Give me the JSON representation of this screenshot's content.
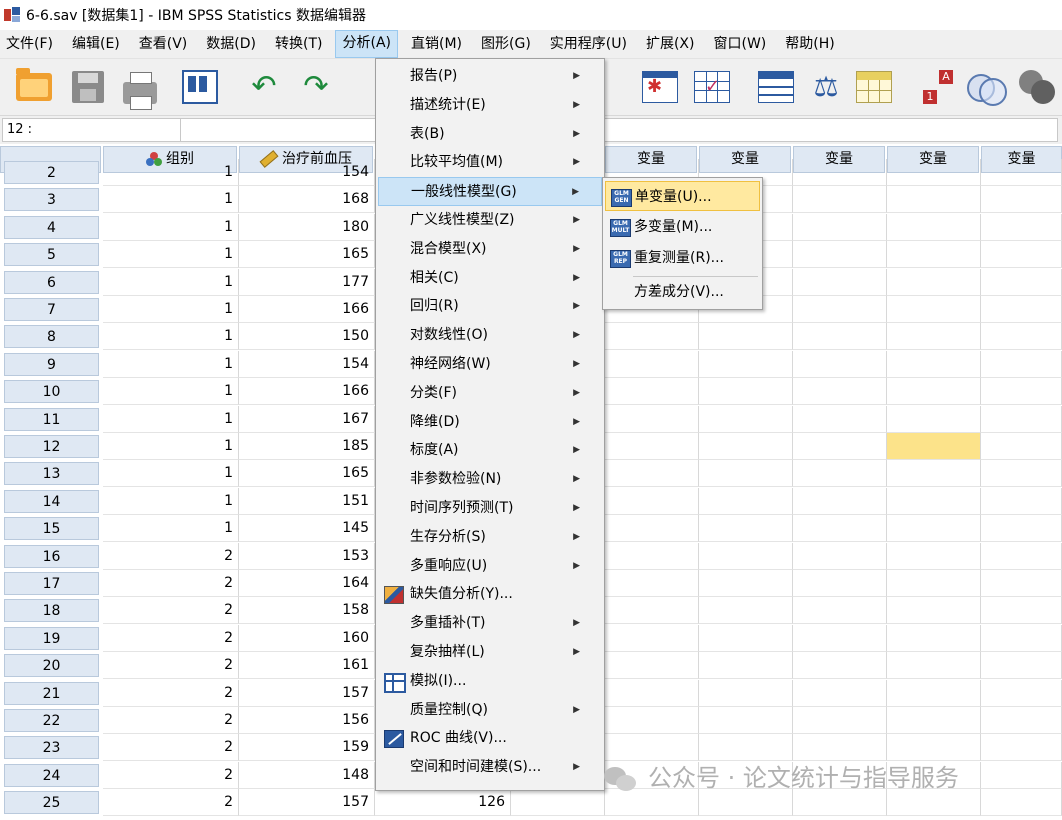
{
  "window": {
    "title": "6-6.sav [数据集1] - IBM SPSS Statistics 数据编辑器"
  },
  "menubar": [
    {
      "label": "文件(F)"
    },
    {
      "label": "编辑(E)"
    },
    {
      "label": "查看(V)"
    },
    {
      "label": "数据(D)"
    },
    {
      "label": "转换(T)"
    },
    {
      "label": "分析(A)"
    },
    {
      "label": "直销(M)"
    },
    {
      "label": "图形(G)"
    },
    {
      "label": "实用程序(U)"
    },
    {
      "label": "扩展(X)"
    },
    {
      "label": "窗口(W)"
    },
    {
      "label": "帮助(H)"
    }
  ],
  "cellbar": {
    "ref": "12 :",
    "value": ""
  },
  "columns": [
    {
      "label": "组别",
      "icon": "nominal-icon"
    },
    {
      "label": "治疗前血压",
      "icon": "scale-ruler-icon"
    },
    {
      "label": ""
    },
    {
      "label": ""
    },
    {
      "label": "变量"
    },
    {
      "label": "变量"
    },
    {
      "label": "变量"
    },
    {
      "label": "变量"
    },
    {
      "label": "变量"
    }
  ],
  "rows": [
    {
      "num": "2",
      "group": "1",
      "bp": "154",
      "c3": ""
    },
    {
      "num": "3",
      "group": "1",
      "bp": "168",
      "c3": ""
    },
    {
      "num": "4",
      "group": "1",
      "bp": "180",
      "c3": ""
    },
    {
      "num": "5",
      "group": "1",
      "bp": "165",
      "c3": ""
    },
    {
      "num": "6",
      "group": "1",
      "bp": "177",
      "c3": ""
    },
    {
      "num": "7",
      "group": "1",
      "bp": "166",
      "c3": ""
    },
    {
      "num": "8",
      "group": "1",
      "bp": "150",
      "c3": ""
    },
    {
      "num": "9",
      "group": "1",
      "bp": "154",
      "c3": ""
    },
    {
      "num": "10",
      "group": "1",
      "bp": "166",
      "c3": ""
    },
    {
      "num": "11",
      "group": "1",
      "bp": "167",
      "c3": ""
    },
    {
      "num": "12",
      "group": "1",
      "bp": "185",
      "c3": ""
    },
    {
      "num": "13",
      "group": "1",
      "bp": "165",
      "c3": ""
    },
    {
      "num": "14",
      "group": "1",
      "bp": "151",
      "c3": ""
    },
    {
      "num": "15",
      "group": "1",
      "bp": "145",
      "c3": ""
    },
    {
      "num": "16",
      "group": "2",
      "bp": "153",
      "c3": ""
    },
    {
      "num": "17",
      "group": "2",
      "bp": "164",
      "c3": ""
    },
    {
      "num": "18",
      "group": "2",
      "bp": "158",
      "c3": ""
    },
    {
      "num": "19",
      "group": "2",
      "bp": "160",
      "c3": ""
    },
    {
      "num": "20",
      "group": "2",
      "bp": "161",
      "c3": ""
    },
    {
      "num": "21",
      "group": "2",
      "bp": "157",
      "c3": ""
    },
    {
      "num": "22",
      "group": "2",
      "bp": "156",
      "c3": ""
    },
    {
      "num": "23",
      "group": "2",
      "bp": "159",
      "c3": ""
    },
    {
      "num": "24",
      "group": "2",
      "bp": "148",
      "c3": ""
    },
    {
      "num": "25",
      "group": "2",
      "bp": "157",
      "c3": "126"
    }
  ],
  "analyze_menu": [
    {
      "label": "报告(P)",
      "submenu": true
    },
    {
      "label": "描述统计(E)",
      "submenu": true
    },
    {
      "label": "表(B)",
      "submenu": true
    },
    {
      "label": "比较平均值(M)",
      "submenu": true
    },
    {
      "label": "一般线性模型(G)",
      "submenu": true,
      "highlighted": true
    },
    {
      "label": "广义线性模型(Z)",
      "submenu": true
    },
    {
      "label": "混合模型(X)",
      "submenu": true
    },
    {
      "label": "相关(C)",
      "submenu": true
    },
    {
      "label": "回归(R)",
      "submenu": true
    },
    {
      "label": "对数线性(O)",
      "submenu": true
    },
    {
      "label": "神经网络(W)",
      "submenu": true
    },
    {
      "label": "分类(F)",
      "submenu": true
    },
    {
      "label": "降维(D)",
      "submenu": true
    },
    {
      "label": "标度(A)",
      "submenu": true
    },
    {
      "label": "非参数检验(N)",
      "submenu": true
    },
    {
      "label": "时间序列预测(T)",
      "submenu": true
    },
    {
      "label": "生存分析(S)",
      "submenu": true
    },
    {
      "label": "多重响应(U)",
      "submenu": true
    },
    {
      "label": "缺失值分析(Y)...",
      "submenu": false,
      "icon": "missing-values-icon"
    },
    {
      "label": "多重插补(T)",
      "submenu": true
    },
    {
      "label": "复杂抽样(L)",
      "submenu": true
    },
    {
      "label": "模拟(I)...",
      "submenu": false,
      "icon": "simulation-icon"
    },
    {
      "label": "质量控制(Q)",
      "submenu": true
    },
    {
      "label": "ROC 曲线(V)...",
      "submenu": false,
      "icon": "roc-curve-icon"
    },
    {
      "label": "空间和时间建模(S)...",
      "submenu": true
    }
  ],
  "glm_submenu": [
    {
      "label": "单变量(U)...",
      "icon_text": "GLM GEN",
      "highlighted": true
    },
    {
      "label": "多变量(M)...",
      "icon_text": "GLM MULT"
    },
    {
      "label": "重复测量(R)...",
      "icon_text": "GLM REP"
    },
    {
      "label": "方差成分(V)..."
    }
  ],
  "watermark": {
    "text": "公众号 · 论文统计与指导服务"
  },
  "colors": {
    "menu_highlight": "#cce4f7",
    "submenu_highlight": "#ffe9a0",
    "selected_cell": "#fce38a",
    "header_bg": "#dfe8f3"
  }
}
